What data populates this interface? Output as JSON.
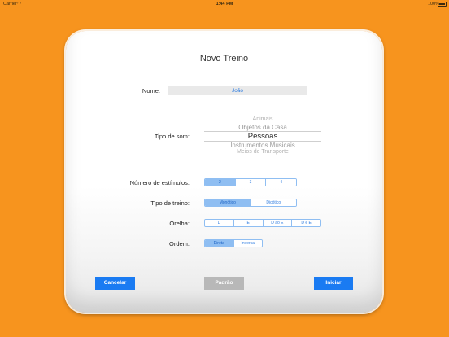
{
  "status_bar": {
    "carrier": "Carrier",
    "time": "1:44 PM",
    "battery": "100%"
  },
  "form": {
    "title": "Novo Treino",
    "name": {
      "label": "Nome:",
      "value": "João"
    },
    "sound_type": {
      "label": "Tipo de som:",
      "options": [
        "Animais",
        "Objetos da Casa",
        "Pessoas",
        "Instrumentos Musicais",
        "Meios de Transporte"
      ],
      "selected": "Pessoas"
    },
    "stimuli": {
      "label": "Número de estímulos:",
      "options": [
        "2",
        "3",
        "4"
      ],
      "selected": "2"
    },
    "training_type": {
      "label": "Tipo de treino:",
      "options": [
        "Monótico",
        "Dicótico"
      ],
      "selected": "Monótico"
    },
    "ear": {
      "label": "Orelha:",
      "options": [
        "D",
        "E",
        "D ao E",
        "D e E"
      ],
      "selected": null
    },
    "order": {
      "label": "Ordem:",
      "options": [
        "Direta",
        "Inversa"
      ],
      "selected": "Direta"
    }
  },
  "buttons": {
    "cancel": "Cancelar",
    "default": "Padrão",
    "start": "Iniciar"
  }
}
